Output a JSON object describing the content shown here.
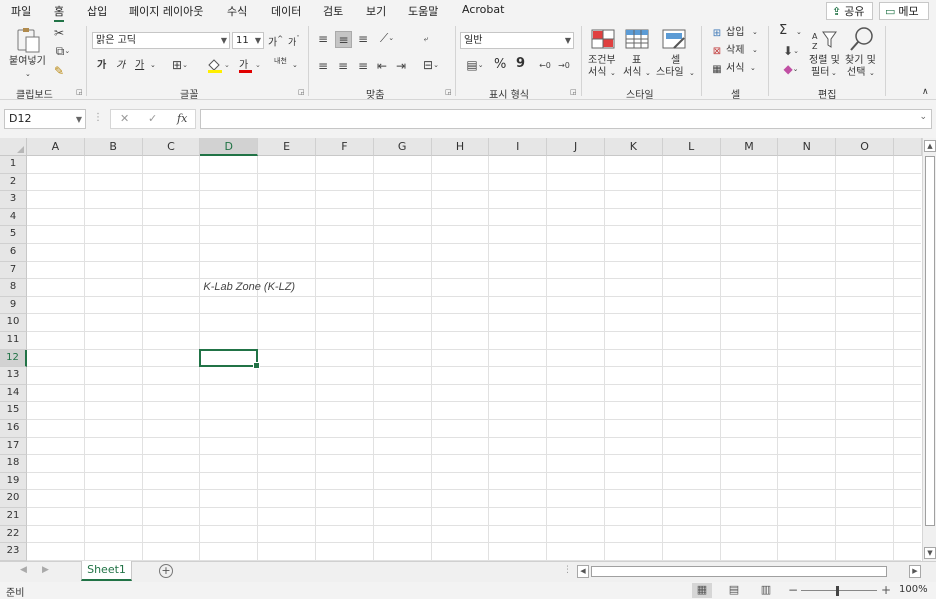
{
  "menu": {
    "tabs": [
      "파일",
      "홈",
      "삽입",
      "페이지 레이아웃",
      "수식",
      "데이터",
      "검토",
      "보기",
      "도움말",
      "Acrobat"
    ],
    "share": "공유",
    "memo": "메모"
  },
  "ribbon": {
    "clipboard": {
      "paste": "붙여넣기",
      "label": "클립보드"
    },
    "font": {
      "name": "맑은 고딕",
      "size": "11",
      "grow": "가",
      "shrink": "가",
      "bold": "가",
      "italic": "가",
      "underline": "가",
      "color_glyph": "가",
      "phonetic": "내천",
      "label": "글꼴"
    },
    "alignment": {
      "label": "맞춤"
    },
    "number": {
      "format": "일반",
      "percent": "%",
      "comma": "9",
      "label": "표시 형식"
    },
    "styles": {
      "conditional_l1": "조건부",
      "conditional_l2": "서식",
      "table_l1": "표",
      "table_l2": "서식",
      "cell_l1": "셀",
      "cell_l2": "스타일",
      "label": "스타일"
    },
    "cells": {
      "insert": "삽입",
      "delete": "삭제",
      "format": "서식",
      "label": "셀"
    },
    "editing": {
      "sort_l1": "정렬 및",
      "sort_l2": "필터",
      "find_l1": "찾기 및",
      "find_l2": "선택",
      "sigma": "Σ",
      "label": "편집"
    }
  },
  "formula_bar": {
    "name_box": "D12",
    "cancel": "✕",
    "enter": "✓",
    "fx": "fx",
    "formula": ""
  },
  "sheet": {
    "columns": [
      "A",
      "B",
      "C",
      "D",
      "E",
      "F",
      "G",
      "H",
      "I",
      "J",
      "K",
      "L",
      "M",
      "N",
      "O"
    ],
    "rows": [
      "1",
      "2",
      "3",
      "4",
      "5",
      "6",
      "7",
      "8",
      "9",
      "10",
      "11",
      "12",
      "13",
      "14",
      "15",
      "16",
      "17",
      "18",
      "19",
      "20",
      "21",
      "22",
      "23"
    ],
    "selected_column": "D",
    "selected_row": "12",
    "cells": [
      {
        "ref": "D8",
        "value": "K-Lab Zone (K-LZ)"
      }
    ]
  },
  "tabs": {
    "sheets": [
      "Sheet1"
    ],
    "add": "+"
  },
  "status": {
    "ready": "준비",
    "zoom": "100%",
    "minus": "−",
    "plus": "+"
  }
}
